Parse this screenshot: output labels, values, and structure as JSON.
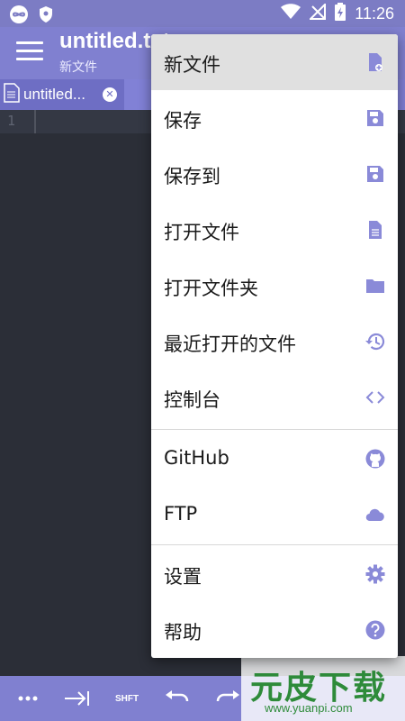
{
  "status_bar": {
    "time": "11:26"
  },
  "app_bar": {
    "title": "untitled.txt",
    "subtitle": "新文件"
  },
  "tab": {
    "label": "untitled..."
  },
  "editor": {
    "line_number": "1"
  },
  "menu": {
    "items": [
      {
        "label": "新文件",
        "icon": "new-file-icon"
      },
      {
        "label": "保存",
        "icon": "save-icon"
      },
      {
        "label": "保存到",
        "icon": "save-to-icon"
      },
      {
        "label": "打开文件",
        "icon": "file-icon"
      },
      {
        "label": "打开文件夹",
        "icon": "folder-icon"
      },
      {
        "label": "最近打开的文件",
        "icon": "history-icon"
      },
      {
        "label": "控制台",
        "icon": "code-icon"
      },
      {
        "label": "GitHub",
        "icon": "github-icon"
      },
      {
        "label": "FTP",
        "icon": "cloud-icon"
      },
      {
        "label": "设置",
        "icon": "gear-icon"
      },
      {
        "label": "帮助",
        "icon": "help-icon"
      }
    ]
  },
  "toolbar": {
    "shift_label": "SHFT"
  },
  "watermark": {
    "text_cn": "元皮下载",
    "url": "www.yuanpi.com"
  },
  "colors": {
    "primary": "#8080d0",
    "icon": "#8a8ad8",
    "editor_bg": "#2b2e37"
  }
}
